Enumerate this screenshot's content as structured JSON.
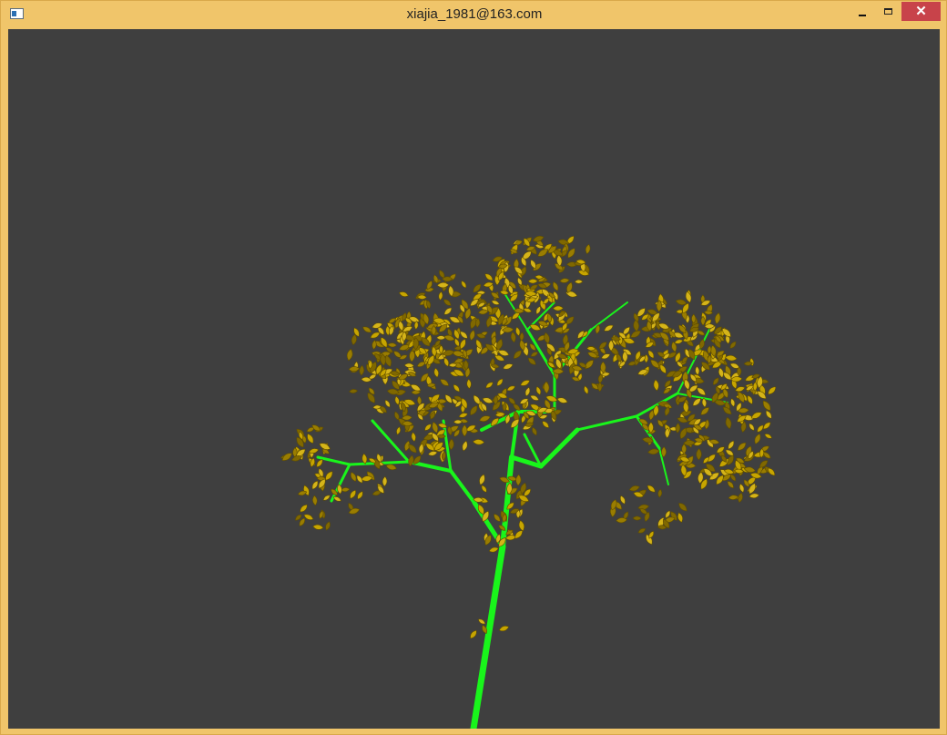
{
  "window": {
    "title": "xiajia_1981@163.com",
    "icons": {
      "app": "window-app-icon",
      "minimize": "minimize-icon",
      "maximize": "maximize-icon",
      "close": "close-icon"
    },
    "close_glyph": "✕"
  },
  "scene": {
    "background": "#3f3f3f",
    "branch_color": "#19f51b",
    "leaf_colors": [
      "#c7a500",
      "#9a7d00",
      "#d5b419",
      "#806800"
    ]
  }
}
